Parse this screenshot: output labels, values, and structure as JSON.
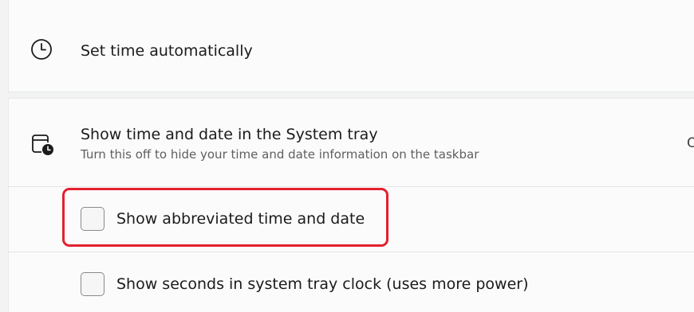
{
  "set_time_automatically": {
    "label": "Set time automatically",
    "icon": "clock-icon"
  },
  "system_tray": {
    "label": "Show time and date in the System tray",
    "description": "Turn this off to hide your time and date information on the taskbar",
    "icon": "calendar-clock-icon",
    "right_edge_text": "O"
  },
  "options": [
    {
      "label": "Show abbreviated time and date",
      "checked": false
    },
    {
      "label": "Show seconds in system tray clock (uses more power)",
      "checked": false
    }
  ],
  "colors": {
    "highlight": "#e4202c",
    "card": "#fbfbfb",
    "background": "#f3f3f3"
  }
}
